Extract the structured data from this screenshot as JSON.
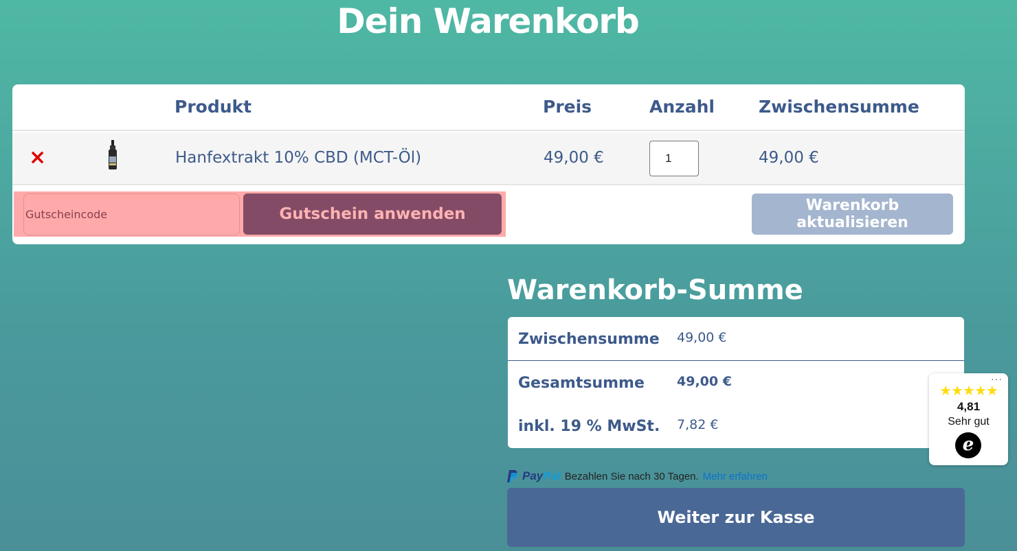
{
  "page": {
    "title": "Dein Warenkorb"
  },
  "cart": {
    "headers": {
      "product": "Produkt",
      "price": "Preis",
      "quantity": "Anzahl",
      "subtotal": "Zwischensumme"
    },
    "items": [
      {
        "remove_symbol": "×",
        "name": "Hanfextrakt 10% CBD (MCT-Öl)",
        "price": "49,00 €",
        "quantity": "1",
        "subtotal": "49,00 €",
        "image_icon": "cbd-oil-bottle-icon"
      }
    ],
    "coupon": {
      "placeholder": "Gutscheincode",
      "apply_label": "Gutschein anwenden"
    },
    "update_label": "Warenkorb aktualisieren"
  },
  "totals": {
    "title": "Warenkorb-Summe",
    "subtotal_label": "Zwischensumme",
    "subtotal_value": "49,00 €",
    "total_label": "Gesamtsumme",
    "total_value": "49,00 €",
    "tax_label": "inkl. 19 % MwSt.",
    "tax_value": "7,82 €"
  },
  "paypal": {
    "logo_pay": "Pay",
    "logo_pal": "Pal",
    "message": "Bezahlen Sie nach 30 Tagen.",
    "link": "Mehr erfahren"
  },
  "checkout_label": "Weiter zur Kasse",
  "trust_badge": {
    "menu": "···",
    "stars": "★★★★★",
    "rating": "4,81",
    "label": "Sehr gut",
    "logo_letter": "e"
  },
  "colors": {
    "accent": "#3d5a8a",
    "coupon_button": "#834b66",
    "checkout_button": "#4a6896",
    "remove": "#e00000",
    "stars": "#ffdc0f"
  }
}
